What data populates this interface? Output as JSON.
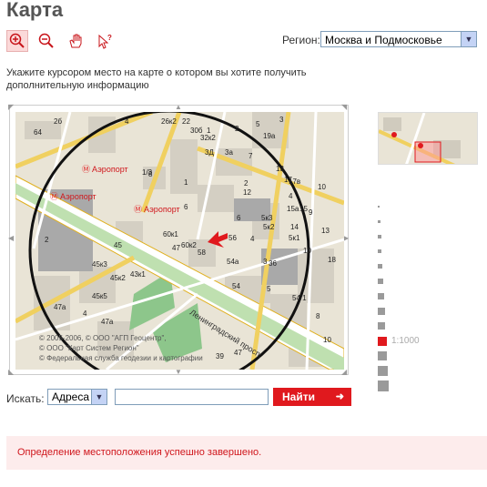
{
  "page": {
    "title": "Карта"
  },
  "toolbar": {
    "tools": [
      {
        "name": "zoom-in-icon",
        "active": true
      },
      {
        "name": "zoom-out-icon",
        "active": false
      },
      {
        "name": "hand-pan-icon",
        "active": false
      },
      {
        "name": "info-pointer-icon",
        "active": false
      }
    ]
  },
  "region": {
    "label": "Регион:",
    "selected": "Москва и Подмосковье"
  },
  "hint": "Укажите курсором место на карте о котором вы хотите получить дополнительную информацию",
  "map": {
    "metro": [
      "Аэропорт",
      "Аэропорт",
      "Аэропорт"
    ],
    "street": "Ленинградский просп.",
    "copyright": [
      "© 2005-2006, © ООО \"АГП Геоцентр\",",
      "© ООО \"Карт Систем Регион\"",
      "© Федеральная служба геодезии и картографии"
    ],
    "buildings": [
      "64",
      "2б",
      "4",
      "26к2",
      "22",
      "30б",
      "32к2",
      "1",
      "2",
      "5",
      "3",
      "19а",
      "3Д",
      "3а",
      "7",
      "13",
      "17",
      "17в",
      "2",
      "10",
      "8",
      "1",
      "1/3",
      "6",
      "12",
      "4",
      "15а",
      "15",
      "9",
      "60к1",
      "6",
      "5к3",
      "5к2",
      "14",
      "13",
      "10",
      "18",
      "2",
      "47",
      "60к2",
      "58",
      "56",
      "4",
      "5к1",
      "45",
      "45к3",
      "45к2",
      "43к1",
      "54а",
      "3",
      "36",
      "54",
      "45к5",
      "5",
      "54/1",
      "4",
      "47а",
      "47",
      "8",
      "10",
      "39",
      "47а"
    ]
  },
  "zoom": {
    "scale": "1:1000",
    "levels": 13,
    "current": 9
  },
  "search": {
    "label": "Искать:",
    "type": "Адреса",
    "value": "",
    "button": "Найти"
  },
  "status": "Определение местоположения успешно завершено.",
  "colors": {
    "accent": "#e0191e",
    "status_bg": "#fdecec",
    "map_bg": "#e9e4d6"
  }
}
